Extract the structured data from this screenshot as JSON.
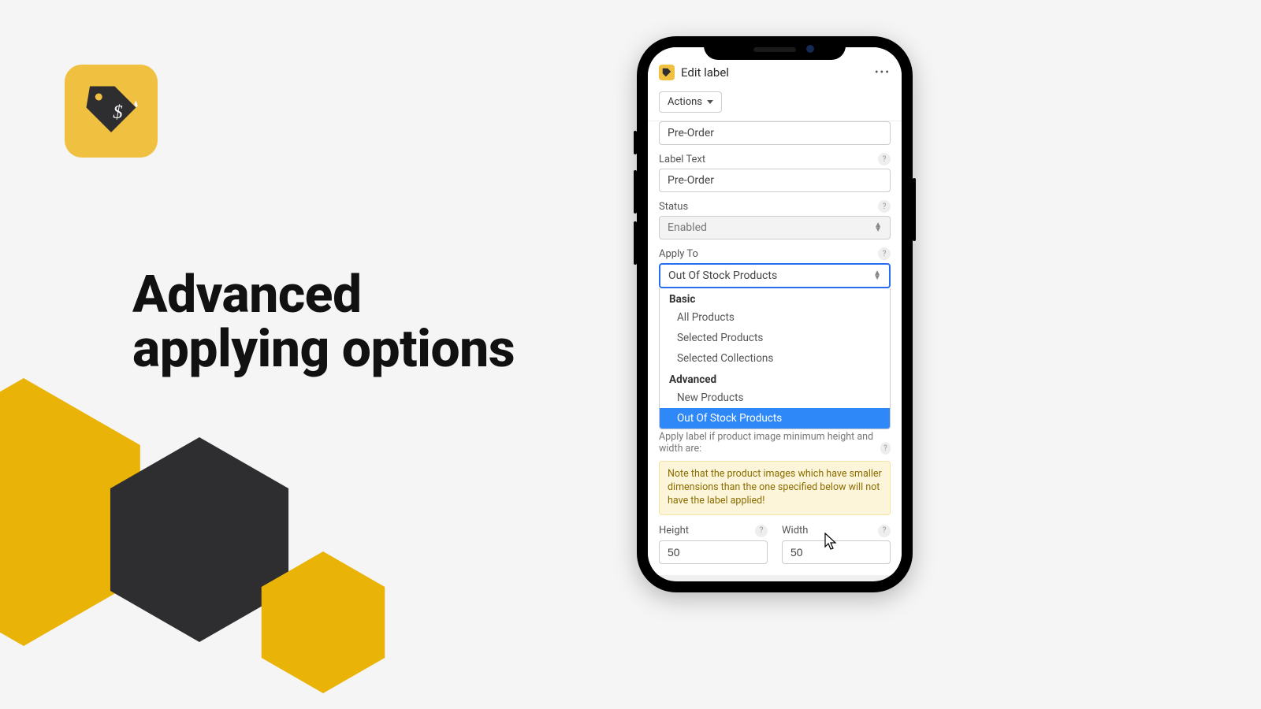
{
  "heading": {
    "line1": "Advanced",
    "line2": "applying options"
  },
  "topbar": {
    "title": "Edit label"
  },
  "actions": {
    "label": "Actions"
  },
  "fields": {
    "name_value": "Pre-Order",
    "label_text_label": "Label Text",
    "label_text_value": "Pre-Order",
    "status_label": "Status",
    "status_value": "Enabled",
    "apply_to_label": "Apply To",
    "apply_to_value": "Out Of Stock Products"
  },
  "dropdown": {
    "group1": "Basic",
    "item1": "All Products",
    "item2": "Selected Products",
    "item3": "Selected Collections",
    "group2": "Advanced",
    "item4": "New Products",
    "item5": "Out Of Stock Products"
  },
  "apply_hint": {
    "line": "Apply label if product image minimum height and width are:"
  },
  "note": "Note that the product images which have smaller dimensions than the one specified below will not have the label applied!",
  "dims": {
    "height_label": "Height",
    "height_value": "50",
    "width_label": "Width",
    "width_value": "50"
  }
}
